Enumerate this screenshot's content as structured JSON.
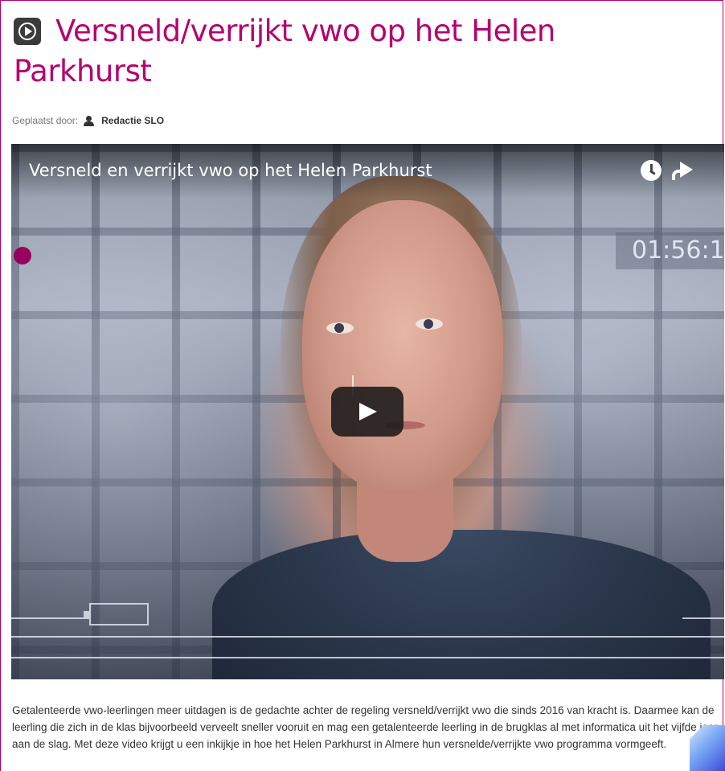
{
  "article": {
    "title": "Versneld/verrijkt vwo op het Helen Parkhurst",
    "byline_label": "Geplaatst door:",
    "author": "Redactie SLO",
    "description": "Getalenteerde vwo-leerlingen meer uitdagen is de gedachte achter de regeling versneld/verrijkt vwo die sinds 2016 van kracht is. Daarmee kan de leerling die zich in de klas bijvoorbeeld verveelt sneller vooruit en mag een getalenteerde leerling in de brugklas al met informatica uit het vijfde jaar aan de slag. Met deze video krijgt u een inkijkje in hoe het Helen Parkhurst in Almere hun versnelde/verrijkte vwo programma vormgeeft."
  },
  "video": {
    "title": "Versneld en verrijkt vwo op het Helen Parkhurst",
    "timecode": "01:56:1",
    "icons": {
      "badge": "video-icon",
      "watch_later": "clock-icon",
      "share": "share-icon",
      "play": "play-icon",
      "author": "user-icon"
    }
  },
  "colors": {
    "brand": "#b5006f",
    "frame": "#b0006c",
    "record_dot": "#98005e"
  }
}
